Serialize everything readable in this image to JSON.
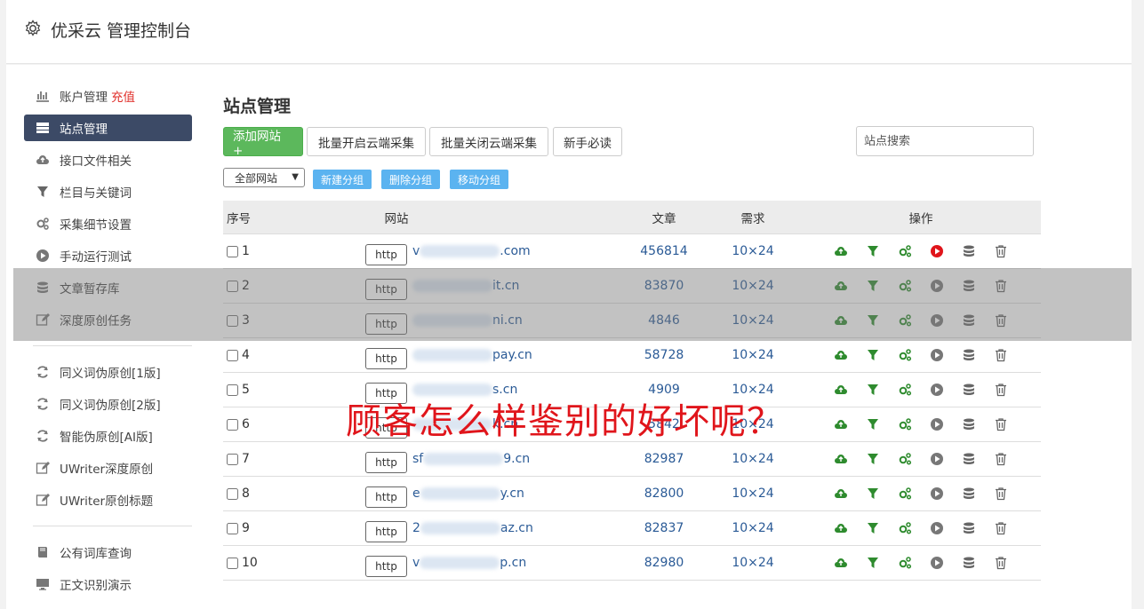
{
  "header": {
    "title": "优采云 管理控制台"
  },
  "sidebar": {
    "items": [
      {
        "label": "账户管理",
        "badge": "充值",
        "icon": "bar-chart-icon"
      },
      {
        "label": "站点管理",
        "icon": "server-icon",
        "active": true
      },
      {
        "label": "接口文件相关",
        "icon": "cloud-upload-icon"
      },
      {
        "label": "栏目与关键词",
        "icon": "filter-icon"
      },
      {
        "label": "采集细节设置",
        "icon": "gears-icon"
      },
      {
        "label": "手动运行测试",
        "icon": "play-circle-icon"
      },
      {
        "label": "文章暂存库",
        "icon": "database-icon"
      },
      {
        "label": "深度原创任务",
        "icon": "edit-icon"
      }
    ],
    "items2": [
      {
        "label": "同义词伪原创[1版]",
        "icon": "refresh-icon"
      },
      {
        "label": "同义词伪原创[2版]",
        "icon": "refresh-icon"
      },
      {
        "label": "智能伪原创[AI版]",
        "icon": "refresh-icon"
      },
      {
        "label": "UWriter深度原创",
        "icon": "edit-icon"
      },
      {
        "label": "UWriter原创标题",
        "icon": "edit-icon"
      }
    ],
    "items3": [
      {
        "label": "公有词库查询",
        "icon": "book-icon"
      },
      {
        "label": "正文识别演示",
        "icon": "monitor-icon"
      }
    ]
  },
  "main": {
    "title": "站点管理",
    "toolbar": {
      "add": "添加网站 +",
      "batch_on": "批量开启云端采集",
      "batch_off": "批量关闭云端采集",
      "guide": "新手必读",
      "search_placeholder": "站点搜索"
    },
    "group": {
      "select": "全部网站",
      "new": "新建分组",
      "delete": "删除分组",
      "move": "移动分组"
    },
    "table": {
      "headers": [
        "序号",
        "网站",
        "文章",
        "需求",
        "操作"
      ],
      "protocol_label": "http",
      "rows": [
        {
          "no": "1",
          "domain_prefix": "v",
          "domain": ".com",
          "articles": "456814",
          "need": "10×24",
          "play_active": true
        },
        {
          "no": "2",
          "domain_prefix": "",
          "domain": "it.cn",
          "articles": "83870",
          "need": "10×24",
          "play_active": false
        },
        {
          "no": "3",
          "domain_prefix": "",
          "domain": "ni.cn",
          "articles": "4846",
          "need": "10×24",
          "play_active": false
        },
        {
          "no": "4",
          "domain_prefix": "",
          "domain": "pay.cn",
          "articles": "58728",
          "need": "10×24",
          "play_active": false
        },
        {
          "no": "5",
          "domain_prefix": "",
          "domain": "s.cn",
          "articles": "4909",
          "need": "10×24",
          "play_active": false
        },
        {
          "no": "6",
          "domain_prefix": "",
          "domain": "k.cn",
          "articles": "5842",
          "need": "10×24",
          "play_active": false
        },
        {
          "no": "7",
          "domain_prefix": "sf",
          "domain": "9.cn",
          "articles": "82987",
          "need": "10×24",
          "play_active": false
        },
        {
          "no": "8",
          "domain_prefix": "e",
          "domain": "y.cn",
          "articles": "82800",
          "need": "10×24",
          "play_active": false
        },
        {
          "no": "9",
          "domain_prefix": "2",
          "domain": "az.cn",
          "articles": "82837",
          "need": "10×24",
          "play_active": false
        },
        {
          "no": "10",
          "domain_prefix": "v",
          "domain": "p.cn",
          "articles": "82980",
          "need": "10×24",
          "play_active": false
        }
      ]
    }
  },
  "overlay": {
    "text": "顾客怎么样鉴别的好坏呢？"
  },
  "colors": {
    "accent": "#3c4a66",
    "green": "#5cb85c",
    "blue_button": "#5bb3f0",
    "link": "#2a5a96",
    "red": "#e0151b"
  }
}
